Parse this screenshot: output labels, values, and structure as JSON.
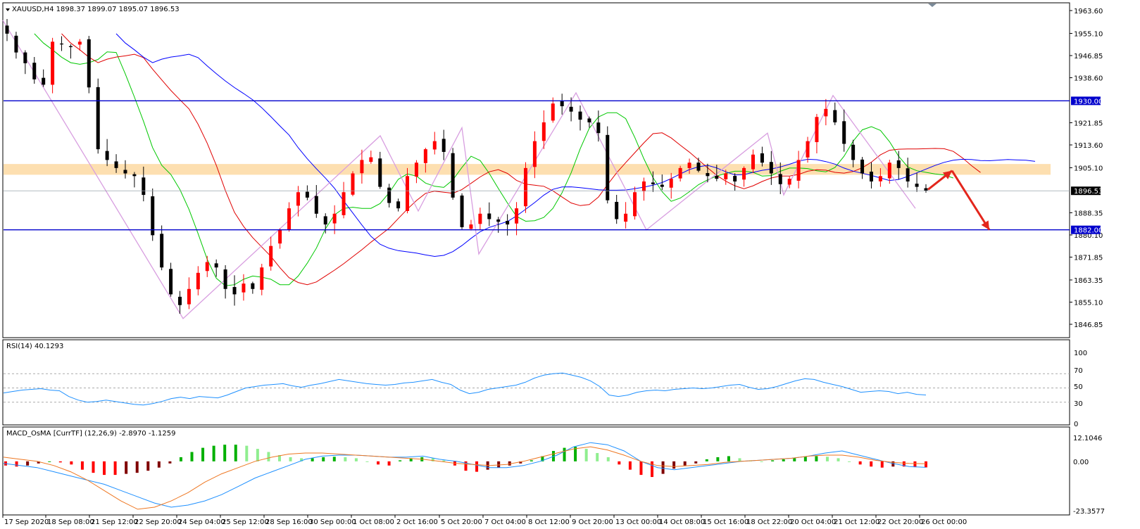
{
  "window": {
    "symbol_header": "XAUUSD,H4  1898.37 1899.07 1895.07 1896.53",
    "menu_arrow_icon": "triangle-down-icon"
  },
  "colors": {
    "bull": "#ff0000",
    "bear": "#000000",
    "ma_fast": "#00c800",
    "ma_mid": "#e00000",
    "ma_slow": "#0000ff",
    "zigzag": "#d89ee0",
    "level_line": "#0000cc",
    "zone": "#fddfb0",
    "arrow": "#e3261c",
    "rsi_line": "#1e90ff",
    "macd_line": "#1e90ff",
    "signal_line": "#ee7722",
    "hist_up_strong": "#00b000",
    "hist_up_weak": "#90ee90",
    "hist_down_strong": "#ff0000",
    "hist_down_weak": "#800000",
    "current_price_tag": "#000000"
  },
  "main_pane": {
    "y_ticks": [
      "1963.60",
      "1955.10",
      "1946.85",
      "1938.60",
      "1930.00",
      "1921.85",
      "1913.60",
      "1905.10",
      "1896.53",
      "1888.35",
      "1880.10",
      "1871.85",
      "1863.35",
      "1855.10",
      "1846.85"
    ],
    "y_tick_values": [
      1963.6,
      1955.1,
      1946.85,
      1938.6,
      1930.0,
      1921.85,
      1913.6,
      1905.1,
      1896.53,
      1888.35,
      1880.1,
      1871.85,
      1863.35,
      1855.1,
      1846.85
    ],
    "level_labels": [
      "1930.00",
      "1882.00"
    ],
    "current_price_label": "1896.53"
  },
  "rsi_pane": {
    "title": "RSI(14) 40.1293",
    "y_ticks": [
      "100",
      "70",
      "50",
      "30",
      "0"
    ]
  },
  "macd_pane": {
    "title": "MACD_OsMA [CurrTF] (12,26,9) -2.8970 -1.1259",
    "y_ticks": [
      "12.1046",
      "0.00",
      "-23.3577"
    ]
  },
  "x_axis": {
    "labels": [
      "17 Sep 2020",
      "18 Sep 08:00",
      "21 Sep 12:00",
      "22 Sep 20:00",
      "24 Sep 04:00",
      "25 Sep 12:00",
      "28 Sep 16:00",
      "30 Sep 00:00",
      "1 Oct 08:00",
      "2 Oct 16:00",
      "5 Oct 20:00",
      "7 Oct 04:00",
      "8 Oct 12:00",
      "9 Oct 20:00",
      "13 Oct 00:00",
      "14 Oct 08:00",
      "15 Oct 16:00",
      "18 Oct 22:00",
      "20 Oct 04:00",
      "21 Oct 12:00",
      "22 Oct 20:00",
      "26 Oct 00:00"
    ]
  },
  "chart_data": [
    {
      "type": "candlestick",
      "symbol": "XAUUSD",
      "timeframe": "H4",
      "ohlc_last": {
        "open": 1898.37,
        "high": 1899.07,
        "low": 1895.07,
        "close": 1896.53
      },
      "ylim": [
        1846.85,
        1963.6
      ],
      "close_path": [
        1955,
        1948,
        1944,
        1938,
        1936,
        1952,
        1951,
        1950,
        1952,
        1935,
        1912,
        1908,
        1905,
        1903,
        1902,
        1895,
        1880,
        1868,
        1858,
        1854,
        1860,
        1866,
        1870,
        1868,
        1860,
        1858,
        1862,
        1860,
        1868,
        1876,
        1882,
        1890,
        1896,
        1894,
        1888,
        1884,
        1888,
        1896,
        1903,
        1908,
        1909,
        1898,
        1892,
        1890,
        1902,
        1907,
        1912,
        1915,
        1911,
        1894,
        1883,
        1884,
        1888,
        1886,
        1885,
        1884,
        1890,
        1905,
        1915,
        1922,
        1929,
        1928,
        1926,
        1923,
        1922,
        1918,
        1893,
        1886,
        1888,
        1896,
        1900,
        1899,
        1898,
        1901,
        1905,
        1907,
        1904,
        1902,
        1901,
        1903,
        1900,
        1905,
        1910,
        1907,
        1903,
        1899,
        1901,
        1908,
        1915,
        1924,
        1927,
        1922,
        1914,
        1908,
        1903,
        1900,
        1902,
        1907,
        1905,
        1900,
        1898,
        1896.53
      ],
      "horizontal_levels": [
        1930.0,
        1882.0
      ],
      "zone": [
        1902.5,
        1906.5
      ],
      "projection_arrows": [
        [
          1897,
          1904
        ],
        [
          1904,
          1882
        ]
      ]
    },
    {
      "type": "line",
      "title": "RSI(14) 40.1293",
      "ylim": [
        0,
        100
      ],
      "levels": [
        70,
        50,
        30
      ],
      "values": [
        43,
        45,
        47,
        48,
        49,
        47,
        46,
        38,
        33,
        30,
        31,
        33,
        31,
        29,
        27,
        26,
        28,
        31,
        35,
        37,
        35,
        38,
        37,
        36,
        40,
        45,
        50,
        52,
        54,
        55,
        56,
        53,
        51,
        54,
        56,
        59,
        62,
        60,
        58,
        56,
        55,
        54,
        55,
        57,
        58,
        60,
        62,
        58,
        55,
        47,
        42,
        44,
        48,
        50,
        52,
        54,
        58,
        64,
        68,
        70,
        71,
        68,
        65,
        60,
        52,
        40,
        38,
        40,
        44,
        46,
        47,
        46,
        48,
        49,
        50,
        49,
        50,
        52,
        54,
        55,
        51,
        48,
        49,
        52,
        56,
        60,
        63,
        62,
        58,
        55,
        52,
        48,
        44,
        45,
        46,
        45,
        42,
        44,
        41,
        40.13
      ]
    },
    {
      "type": "histogram+line",
      "title": "MACD_OsMA [CurrTF] (12,26,9) -2.8970 -1.1259",
      "ylim": [
        -23.3577,
        12.1046
      ],
      "osma": [
        -2,
        -2.5,
        -2,
        -1,
        0,
        -0.5,
        -1.5,
        -4,
        -5.5,
        -6.5,
        -6.5,
        -6,
        -5.5,
        -4.5,
        -3,
        -1,
        2,
        4.5,
        6.5,
        7.5,
        8,
        8,
        7.5,
        6,
        4.5,
        3,
        2,
        1.5,
        1.5,
        2,
        2.2,
        2,
        1.5,
        0,
        -1.5,
        -2,
        0.5,
        1.5,
        2,
        1.5,
        0.5,
        -2,
        -4.5,
        -5,
        -4,
        -3,
        -2,
        -1,
        0.5,
        2.5,
        5,
        6.5,
        7,
        6,
        4,
        2,
        -1.5,
        -4,
        -6.5,
        -7.5,
        -6,
        -3.5,
        -2,
        -1,
        1,
        2,
        2.5,
        1.5,
        0.5,
        0,
        0.5,
        1,
        1.5,
        2.2,
        2.5,
        2.2,
        1.5,
        0,
        -1.5,
        -2.5,
        -3,
        -2.5,
        -2.5,
        -2.8,
        -2.9
      ],
      "macd": [
        -1,
        -2,
        -3,
        -5,
        -7,
        -9,
        -11,
        -14,
        -17,
        -20,
        -22,
        -21,
        -19,
        -16,
        -12,
        -8,
        -5,
        -2,
        1,
        2.5,
        3,
        3,
        2.5,
        2,
        2,
        2.5,
        1,
        0,
        -1.5,
        -3,
        -3,
        -2,
        0,
        3,
        7,
        9,
        8,
        5,
        0,
        -3,
        -4,
        -3,
        -2,
        -1,
        0,
        0.5,
        1,
        1.5,
        2.5,
        4,
        5,
        3,
        1,
        -1,
        -2.5,
        -2.9
      ],
      "signal": [
        2,
        1,
        0,
        -2,
        -5,
        -9,
        -14,
        -19,
        -23,
        -22,
        -19,
        -15,
        -10,
        -6,
        -3,
        0,
        2,
        3.5,
        4,
        4,
        3.5,
        3,
        2.5,
        2,
        1.5,
        1,
        0,
        -1,
        -1.5,
        -2,
        -1.5,
        0,
        2,
        4,
        6,
        7,
        5.5,
        3,
        0,
        -2,
        -2.5,
        -2,
        -1.5,
        -0.5,
        0,
        0.5,
        1,
        1.5,
        2.5,
        3,
        3,
        2,
        0.5,
        -0.5,
        -1,
        -1.13
      ]
    }
  ]
}
